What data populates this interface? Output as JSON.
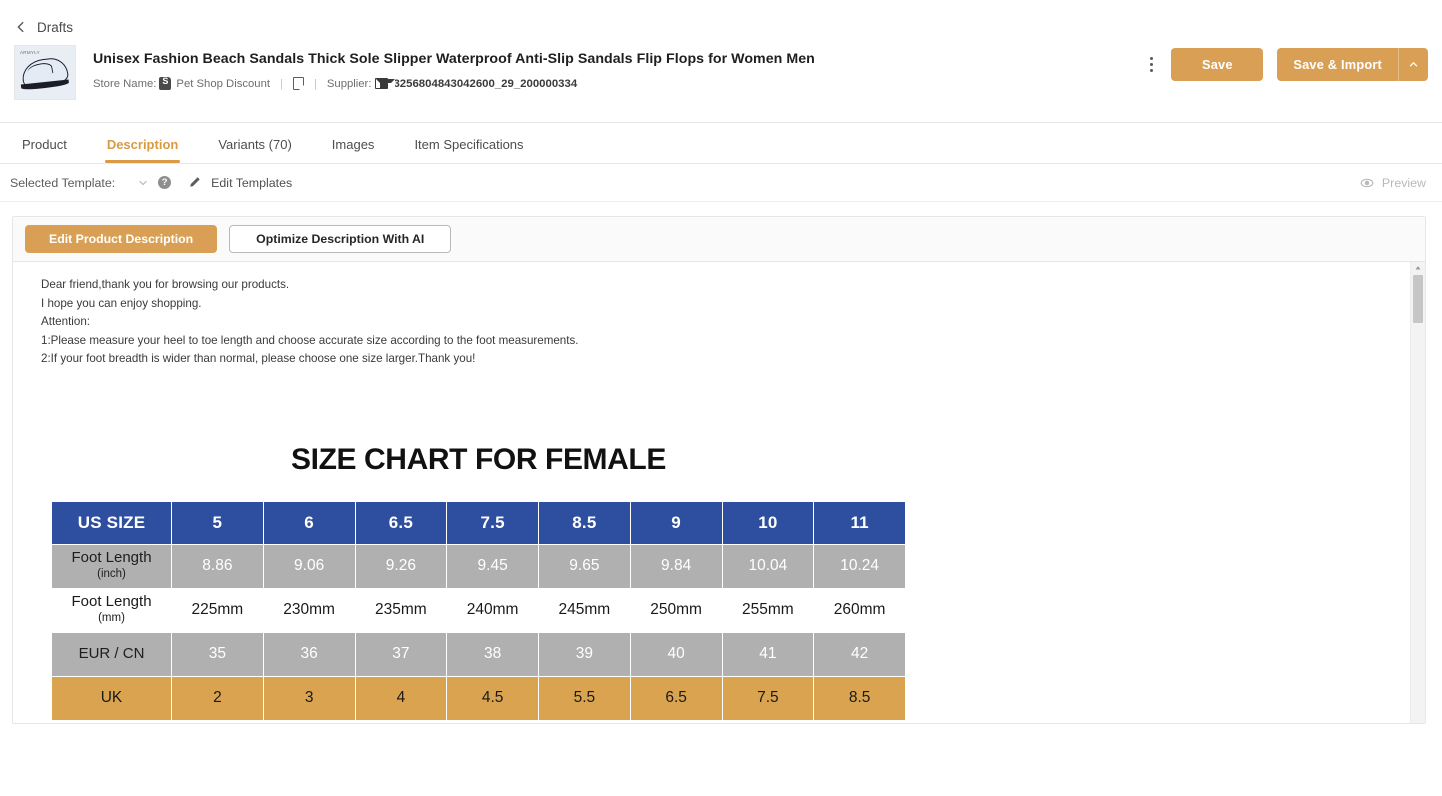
{
  "breadcrumb": {
    "label": "Drafts",
    "icon": "chevron-left-icon"
  },
  "product": {
    "title": "Unisex Fashion Beach Sandals Thick Sole Slipper Waterproof Anti-Slip Sandals Flip Flops for Women Men",
    "store_name_label": "Store Name:",
    "store_name": "Pet Shop Discount",
    "supplier_label": "Supplier:",
    "supplier_id": "3256804843042600_29_200000334",
    "thumbnail_brand": "ARMYLY",
    "separator": "|"
  },
  "header_actions": {
    "kebab": "more-vertical-icon",
    "save_label": "Save",
    "save_import_label": "Save & Import",
    "caret_icon": "chevron-up-icon"
  },
  "tabs": [
    {
      "label": "Product",
      "active": false
    },
    {
      "label": "Description",
      "active": true
    },
    {
      "label": "Variants (70)",
      "active": false
    },
    {
      "label": "Images",
      "active": false
    },
    {
      "label": "Item Specifications",
      "active": false
    }
  ],
  "template_row": {
    "selected_template_label": "Selected Template:",
    "selected_template_value": "",
    "caret_icon": "chevron-down-icon",
    "help_icon": "question-mark-icon",
    "help_glyph": "?",
    "pencil_icon": "pencil-icon",
    "edit_templates_label": "Edit Templates",
    "preview_label": "Preview",
    "preview_icon": "eye-icon"
  },
  "panel_toolbar": {
    "edit_description_label": "Edit Product Description",
    "optimize_ai_label": "Optimize Description With AI"
  },
  "description_lines": [
    "Dear friend,thank you for browsing our products.",
    "I hope you can enjoy shopping.",
    "Attention:",
    "1:Please measure your heel to toe length and choose accurate size according to the foot measurements.",
    "2:If your foot breadth is wider than normal, please choose one size larger.Thank you!"
  ],
  "colors": {
    "accent_orange": "#d9a055",
    "tab_active": "#d99a43",
    "table_header_blue": "#2e4fa0",
    "table_gray": "#b0b0b0",
    "table_tan": "#d9a34f"
  },
  "chart_data": {
    "type": "table",
    "title": "SIZE CHART FOR FEMALE",
    "row_labels": [
      "US SIZE",
      "Foot Length",
      "Foot Length",
      "EUR / CN",
      "UK"
    ],
    "row_units": [
      "",
      "(inch)",
      "(mm)",
      "",
      ""
    ],
    "categories": [
      "5",
      "6",
      "6.5",
      "7.5",
      "8.5",
      "9",
      "10",
      "11"
    ],
    "series": [
      {
        "name": "US SIZE",
        "unit": "",
        "values": [
          "5",
          "6",
          "6.5",
          "7.5",
          "8.5",
          "9",
          "10",
          "11"
        ]
      },
      {
        "name": "Foot Length",
        "unit": "(inch)",
        "values": [
          "8.86",
          "9.06",
          "9.26",
          "9.45",
          "9.65",
          "9.84",
          "10.04",
          "10.24"
        ]
      },
      {
        "name": "Foot Length",
        "unit": "(mm)",
        "values": [
          "225mm",
          "230mm",
          "235mm",
          "240mm",
          "245mm",
          "250mm",
          "255mm",
          "260mm"
        ]
      },
      {
        "name": "EUR / CN",
        "unit": "",
        "values": [
          "35",
          "36",
          "37",
          "38",
          "39",
          "40",
          "41",
          "42"
        ]
      },
      {
        "name": "UK",
        "unit": "",
        "values": [
          "2",
          "3",
          "4",
          "4.5",
          "5.5",
          "6.5",
          "7.5",
          "8.5"
        ]
      }
    ]
  },
  "scrollbar": {
    "up_arrow_icon": "caret-up-icon"
  }
}
